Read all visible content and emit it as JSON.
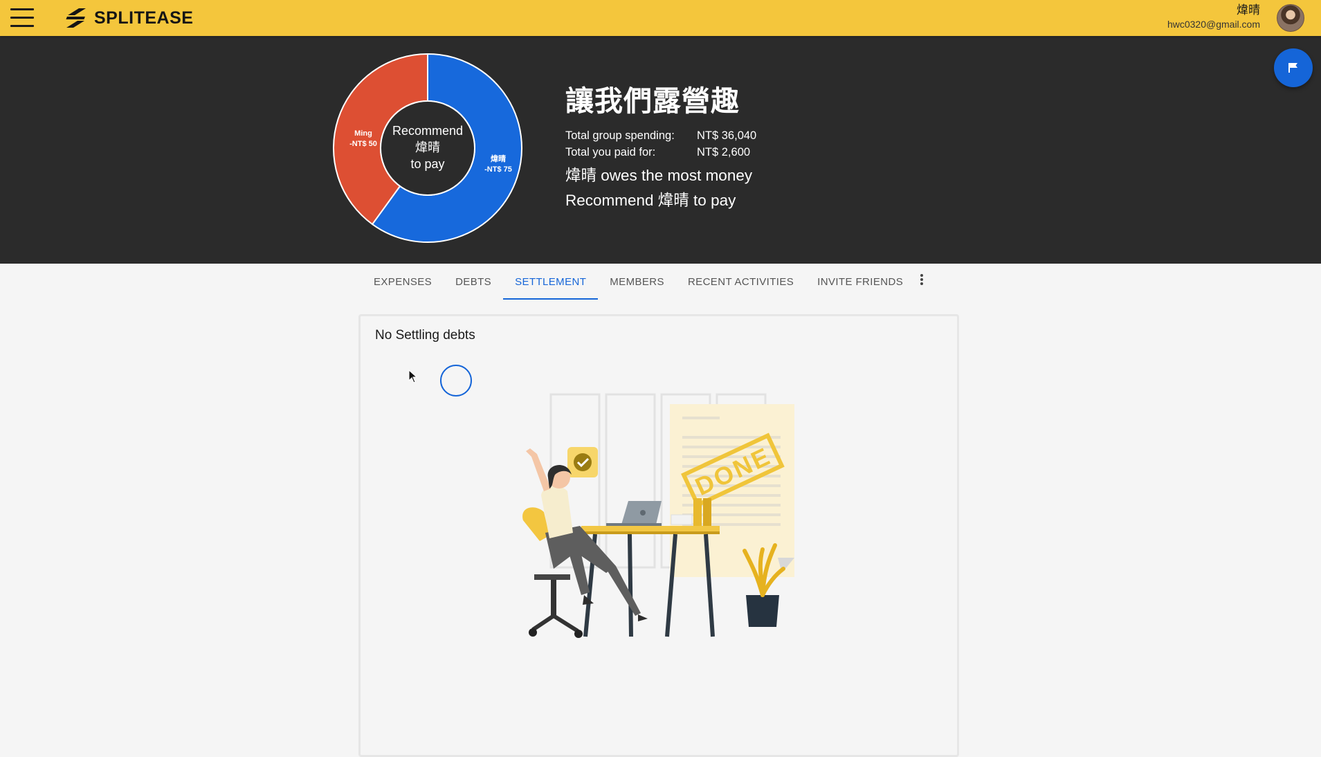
{
  "app": {
    "name": "SPLITEASE",
    "user": {
      "name": "煒晴",
      "email": "hwc0320@gmail.com"
    }
  },
  "group": {
    "title": "讓我們露營趣",
    "stats": [
      {
        "label": "Total group spending:",
        "value": "NT$ 36,040"
      },
      {
        "label": "Total you paid for:",
        "value": "NT$ 2,600"
      }
    ],
    "message_line1": "煒晴 owes the most money",
    "message_line2": "Recommend 煒晴 to pay"
  },
  "donut": {
    "center_line1": "Recommend",
    "center_line2": "煒晴",
    "center_line3": "to pay",
    "segments": [
      {
        "name": "煒晴",
        "amount": "-NT$ 75",
        "value": 75,
        "color": "#1769dc"
      },
      {
        "name": "Ming",
        "amount": "-NT$ 50",
        "value": 50,
        "color": "#dd4f33"
      }
    ]
  },
  "tabs": [
    {
      "label": "EXPENSES",
      "active": false
    },
    {
      "label": "DEBTS",
      "active": false
    },
    {
      "label": "SETTLEMENT",
      "active": true
    },
    {
      "label": "MEMBERS",
      "active": false
    },
    {
      "label": "RECENT ACTIVITIES",
      "active": false
    },
    {
      "label": "INVITE FRIENDS",
      "active": false
    }
  ],
  "settlement": {
    "empty_title": "No Settling debts",
    "illustration_stamp": "DONE"
  },
  "colors": {
    "appbar": "#f4c63c",
    "hero": "#2b2b2b",
    "accent": "#1565d8"
  },
  "icons": {
    "menu": "hamburger-icon",
    "fab": "flag-icon",
    "more": "more-vertical-icon"
  }
}
